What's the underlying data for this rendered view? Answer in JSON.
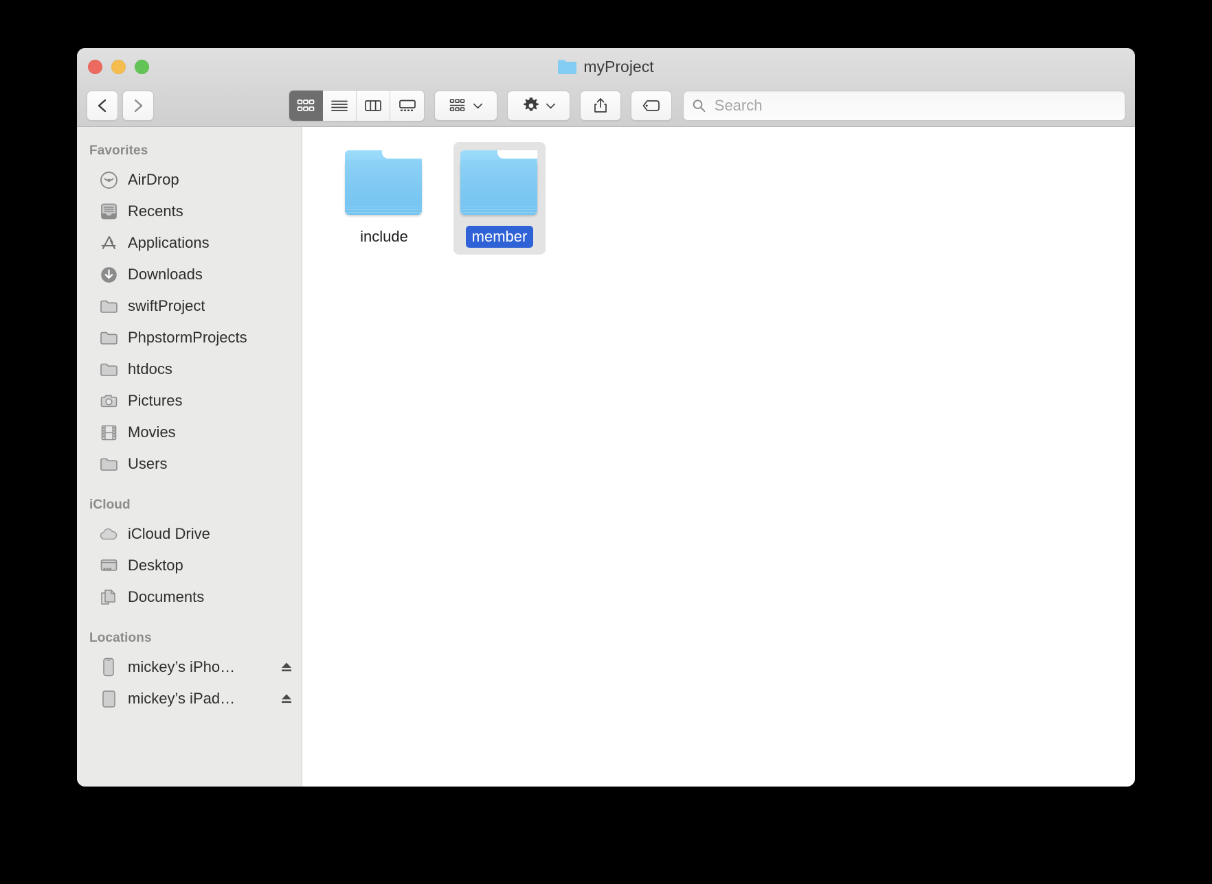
{
  "window": {
    "title": "myProject",
    "title_icon": "folder-icon"
  },
  "traffic_lights": {
    "close_label": "close",
    "minimize_label": "minimize",
    "zoom_label": "zoom",
    "close_color": "#ec6a5f",
    "minimize_color": "#f5bd4f",
    "zoom_color": "#61c454"
  },
  "toolbar": {
    "back_label": "Back",
    "forward_label": "Forward",
    "view_modes": [
      {
        "name": "icon-view",
        "label": "Icon View",
        "active": true
      },
      {
        "name": "list-view",
        "label": "List View",
        "active": false
      },
      {
        "name": "column-view",
        "label": "Column View",
        "active": false
      },
      {
        "name": "gallery-view",
        "label": "Gallery View",
        "active": false
      }
    ],
    "group_label": "Group",
    "action_label": "Action",
    "share_label": "Share",
    "tags_label": "Tags"
  },
  "search": {
    "placeholder": "Search",
    "value": "",
    "icon": "search-icon"
  },
  "sidebar": {
    "sections": [
      {
        "header": "Favorites",
        "items": [
          {
            "label": "AirDrop",
            "icon": "airdrop-icon",
            "eject": false
          },
          {
            "label": "Recents",
            "icon": "recents-icon",
            "eject": false
          },
          {
            "label": "Applications",
            "icon": "applications-icon",
            "eject": false
          },
          {
            "label": "Downloads",
            "icon": "downloads-icon",
            "eject": false
          },
          {
            "label": "swiftProject",
            "icon": "folder-icon",
            "eject": false
          },
          {
            "label": "PhpstormProjects",
            "icon": "folder-icon",
            "eject": false
          },
          {
            "label": "htdocs",
            "icon": "folder-icon",
            "eject": false
          },
          {
            "label": "Pictures",
            "icon": "camera-icon",
            "eject": false
          },
          {
            "label": "Movies",
            "icon": "film-icon",
            "eject": false
          },
          {
            "label": "Users",
            "icon": "folder-icon",
            "eject": false
          }
        ]
      },
      {
        "header": "iCloud",
        "items": [
          {
            "label": "iCloud Drive",
            "icon": "cloud-icon",
            "eject": false
          },
          {
            "label": "Desktop",
            "icon": "desktop-icon",
            "eject": false
          },
          {
            "label": "Documents",
            "icon": "documents-icon",
            "eject": false
          }
        ]
      },
      {
        "header": "Locations",
        "items": [
          {
            "label": "mickey’s iPho…",
            "icon": "iphone-icon",
            "eject": true
          },
          {
            "label": "mickey’s iPad…",
            "icon": "ipad-icon",
            "eject": true
          }
        ]
      }
    ]
  },
  "content": {
    "files": [
      {
        "name": "include",
        "icon": "folder-icon",
        "selected": false
      },
      {
        "name": "member",
        "icon": "folder-icon",
        "selected": true
      }
    ],
    "selection_color": "#2f62d6"
  }
}
